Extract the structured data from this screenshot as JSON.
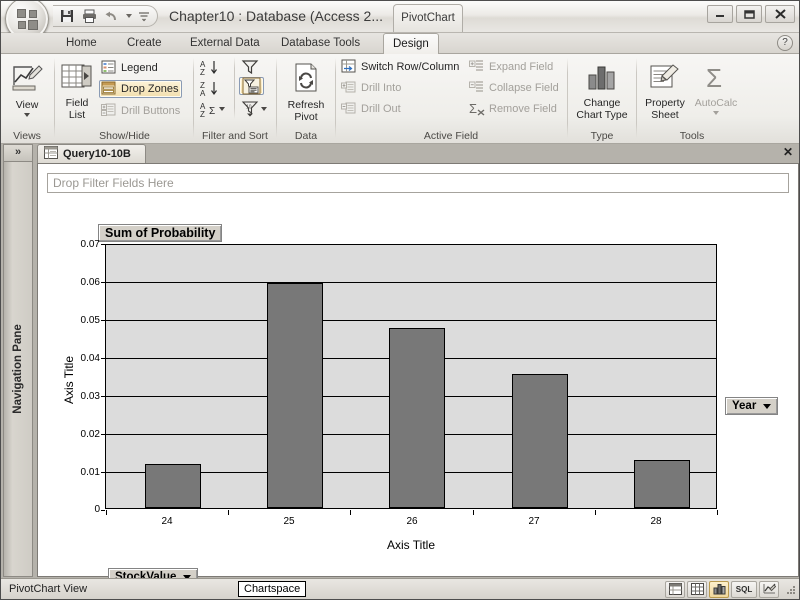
{
  "window": {
    "title": "Chapter10 : Database (Access 2...",
    "contextual_tab_group": "PivotChart",
    "minimize": "—",
    "maximize": "❐",
    "close": "✕"
  },
  "quick_access": {
    "save": "save-icon",
    "print": "print-icon",
    "undo": "undo-icon",
    "undo_dropdown": "chevron-down-icon",
    "customize": "chevron-down-icon"
  },
  "ribbon": {
    "tabs": [
      {
        "label": "Home",
        "active": false
      },
      {
        "label": "Create",
        "active": false
      },
      {
        "label": "External Data",
        "active": false
      },
      {
        "label": "Database Tools",
        "active": false
      },
      {
        "label": "Design",
        "active": true
      }
    ],
    "help_label": "?",
    "groups": [
      {
        "name": "Views",
        "label": "Views",
        "big_buttons": [
          {
            "label": "View",
            "icon": "view-chart-icon",
            "has_dropdown": true
          }
        ]
      },
      {
        "name": "ShowHide",
        "label": "Show/Hide",
        "big_buttons": [
          {
            "label": "Field\nList",
            "icon": "field-list-icon",
            "has_dropdown": false
          }
        ],
        "small_buttons": [
          {
            "label": "Legend",
            "icon": "legend-icon",
            "state": "normal"
          },
          {
            "label": "Drop Zones",
            "icon": "drop-zones-icon",
            "state": "toggled-on"
          },
          {
            "label": "Drill Buttons",
            "icon": "drill-buttons-icon",
            "state": "disabled"
          }
        ]
      },
      {
        "name": "FilterAndSort",
        "label": "Filter and Sort",
        "small_buttons": [
          {
            "label": "",
            "icon": "sort-ascending-icon",
            "state": "normal"
          },
          {
            "label": "",
            "icon": "sort-descending-icon",
            "state": "normal"
          },
          {
            "label": "",
            "icon": "autocalc-sort-icon",
            "state": "normal",
            "has_dropdown": true
          },
          {
            "label": "",
            "icon": "filter-funnel-icon",
            "state": "normal"
          },
          {
            "label": "",
            "icon": "filter-by-selection-icon",
            "state": "toggled-on"
          },
          {
            "label": "",
            "icon": "top10-filter-icon",
            "state": "normal",
            "has_dropdown": true
          }
        ]
      },
      {
        "name": "Data",
        "label": "Data",
        "big_buttons": [
          {
            "label": "Refresh\nPivot",
            "icon": "refresh-pivot-icon",
            "has_dropdown": false
          }
        ]
      },
      {
        "name": "ActiveField",
        "label": "Active Field",
        "small_buttons": [
          {
            "label": "Switch Row/Column",
            "icon": "switch-row-column-icon",
            "state": "normal"
          },
          {
            "label": "Drill Into",
            "icon": "drill-into-icon",
            "state": "disabled"
          },
          {
            "label": "Drill Out",
            "icon": "drill-out-icon",
            "state": "disabled"
          },
          {
            "label": "Expand Field",
            "icon": "expand-field-icon",
            "state": "disabled"
          },
          {
            "label": "Collapse Field",
            "icon": "collapse-field-icon",
            "state": "disabled"
          },
          {
            "label": "Remove Field",
            "icon": "remove-field-icon",
            "state": "disabled"
          }
        ]
      },
      {
        "name": "Type",
        "label": "Type",
        "big_buttons": [
          {
            "label": "Change\nChart Type",
            "icon": "change-chart-type-icon",
            "has_dropdown": false
          }
        ]
      },
      {
        "name": "Tools",
        "label": "Tools",
        "big_buttons": [
          {
            "label": "Property\nSheet",
            "icon": "property-sheet-icon",
            "has_dropdown": false
          },
          {
            "label": "AutoCalc",
            "icon": "autocalc-sigma-icon",
            "has_dropdown": true
          }
        ]
      }
    ]
  },
  "navigation_pane": {
    "label": "Navigation Pane",
    "expand_icon": "»"
  },
  "document": {
    "tab_label": "Query10-10B",
    "tab_icon": "query-icon",
    "close_label": "✕"
  },
  "chartspace": {
    "filter_drop_zone": "Drop Filter Fields Here",
    "series_field_button": "Year",
    "category_field_button": "StockValue",
    "data_field_button": "Sum of Probability",
    "dropdown_icon": "chevron-down-icon"
  },
  "status_bar": {
    "view_label": "PivotChart View",
    "tooltip": "Chartspace",
    "view_buttons": [
      {
        "name": "datasheet-view",
        "icon": "datasheet-view-icon",
        "selected": false
      },
      {
        "name": "pivottable-view",
        "icon": "pivottable-view-icon",
        "selected": false
      },
      {
        "name": "pivotchart-view",
        "icon": "pivotchart-view-icon",
        "selected": true
      },
      {
        "name": "sql-view",
        "icon": "SQL",
        "selected": false
      },
      {
        "name": "design-view",
        "icon": "design-view-icon",
        "selected": false
      }
    ]
  },
  "chart_data": {
    "type": "bar",
    "title": "Sum of Probability",
    "xlabel": "Axis Title",
    "ylabel": "Axis Title",
    "categories": [
      "24",
      "25",
      "26",
      "27",
      "28"
    ],
    "values": [
      0.0118,
      0.0598,
      0.0478,
      0.0357,
      0.0127
    ],
    "ylim": [
      0,
      0.07
    ],
    "ytick_labels": [
      "0.07",
      "0.06",
      "0.05",
      "0.04",
      "0.03",
      "0.02",
      "0.01",
      "0"
    ],
    "ytick_values": [
      0.07,
      0.06,
      0.05,
      0.04,
      0.03,
      0.02,
      0.01,
      0
    ],
    "grid": true,
    "legend": false,
    "series": [
      {
        "name": "Sum of Probability",
        "values": [
          0.0118,
          0.0598,
          0.0478,
          0.0357,
          0.0127
        ]
      }
    ],
    "bar_color": "#787878",
    "plot_background": "#dcdcdc"
  }
}
